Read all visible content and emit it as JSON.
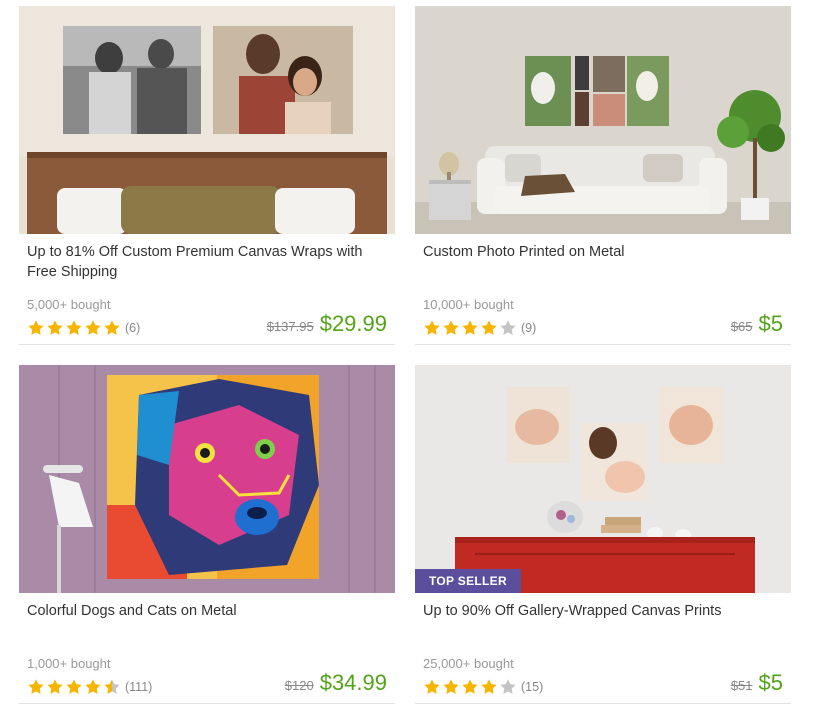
{
  "deals": [
    {
      "title": "Up to 81% Off Custom Premium Canvas Wraps with Free Shipping",
      "bought": "5,000+ bought",
      "rating": 5,
      "rating_count": "(6)",
      "original_price": "$137.95",
      "price": "$29.99",
      "badge": ""
    },
    {
      "title": "Custom Photo Printed on Metal",
      "bought": "10,000+ bought",
      "rating": 4,
      "rating_count": "(9)",
      "original_price": "$65",
      "price": "$5",
      "badge": ""
    },
    {
      "title": "Colorful Dogs and Cats on Metal",
      "bought": "1,000+ bought",
      "rating": 4.5,
      "rating_count": "(111)",
      "original_price": "$120",
      "price": "$34.99",
      "badge": ""
    },
    {
      "title": "Up to 90% Off Gallery-Wrapped Canvas Prints",
      "bought": "25,000+ bought",
      "rating": 4,
      "rating_count": "(15)",
      "original_price": "$51",
      "price": "$5",
      "badge": "TOP SELLER"
    }
  ],
  "colors": {
    "price_green": "#53a318",
    "star_gold": "#f7b500",
    "star_empty": "#c4c4c4",
    "badge_purple": "#5b4f9d"
  },
  "icons": {
    "star": "star-icon",
    "half_star": "half-star-icon"
  }
}
